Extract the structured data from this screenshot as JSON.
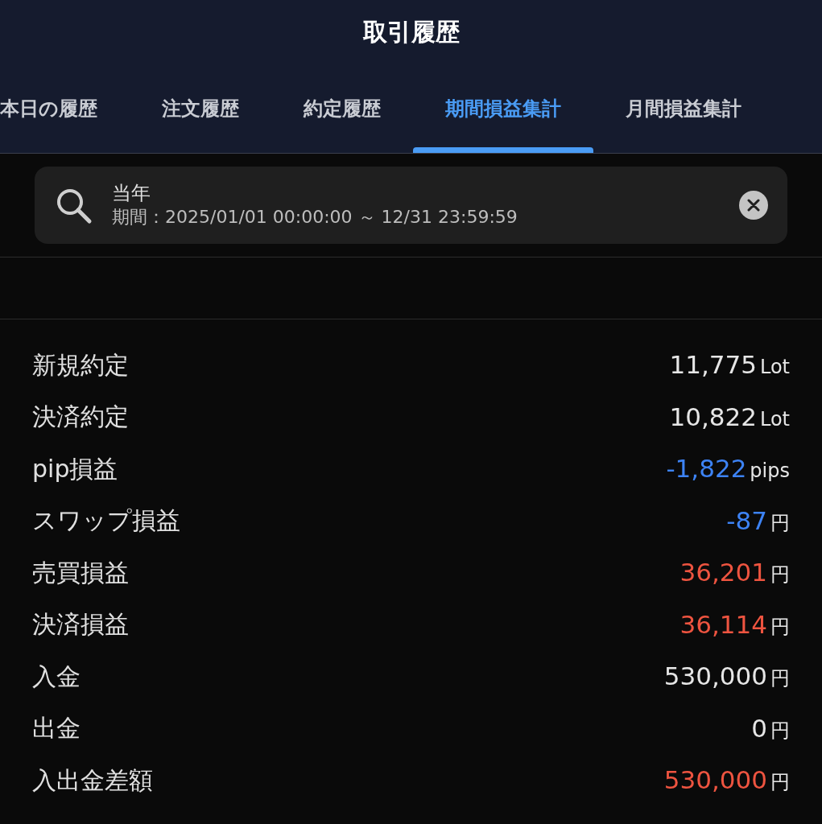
{
  "header": {
    "title": "取引履歴"
  },
  "tabs": [
    {
      "label": "本日の履歴",
      "selected": false
    },
    {
      "label": "注文履歴",
      "selected": false
    },
    {
      "label": "約定履歴",
      "selected": false
    },
    {
      "label": "期間損益集計",
      "selected": true
    },
    {
      "label": "月間損益集計",
      "selected": false
    }
  ],
  "filter": {
    "name": "当年",
    "period": "期間：2025/01/01 00:00:00 ～ 12/31 23:59:59"
  },
  "summary": [
    {
      "label": "新規約定",
      "value": "11,775",
      "unit": "Lot",
      "color": "#e6e6e6"
    },
    {
      "label": "決済約定",
      "value": "10,822",
      "unit": "Lot",
      "color": "#e6e6e6"
    },
    {
      "label": "pip損益",
      "value": "-1,822",
      "unit": "pips",
      "color": "#3d83f5"
    },
    {
      "label": "スワップ損益",
      "value": "-87",
      "unit": "円",
      "color": "#3d83f5"
    },
    {
      "label": "売買損益",
      "value": "36,201",
      "unit": "円",
      "color": "#ee5440"
    },
    {
      "label": "決済損益",
      "value": "36,114",
      "unit": "円",
      "color": "#ee5440"
    },
    {
      "label": "入金",
      "value": "530,000",
      "unit": "円",
      "color": "#e6e6e6"
    },
    {
      "label": "出金",
      "value": "0",
      "unit": "円",
      "color": "#e6e6e6"
    },
    {
      "label": "入出金差額",
      "value": "530,000",
      "unit": "円",
      "color": "#ee5440"
    }
  ]
}
